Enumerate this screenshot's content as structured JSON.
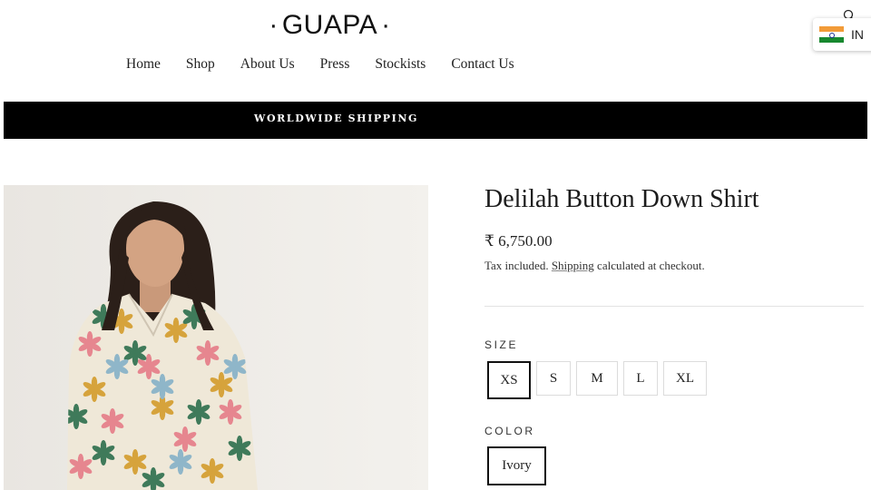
{
  "header": {
    "logo": "GUAPA",
    "nav": [
      "Home",
      "Shop",
      "About Us",
      "Press",
      "Stockists",
      "Contact Us"
    ],
    "country_code": "IN"
  },
  "announcement": "WORLDWIDE SHIPPING",
  "product": {
    "title": "Delilah Button Down Shirt",
    "price": "₹ 6,750.00",
    "tax_prefix": "Tax included.",
    "shipping_link": "Shipping",
    "tax_suffix": "calculated at checkout.",
    "size_label": "SIZE",
    "sizes": [
      "XS",
      "S",
      "M",
      "L",
      "XL"
    ],
    "selected_size": "XS",
    "color_label": "COLOR",
    "colors": [
      "Ivory"
    ],
    "selected_color": "Ivory"
  },
  "colors": {
    "announcement_bg": "#000000",
    "text": "#1c1c1c",
    "selected_border": "#111111"
  },
  "icons": [
    "search-icon",
    "india-flag-icon"
  ]
}
